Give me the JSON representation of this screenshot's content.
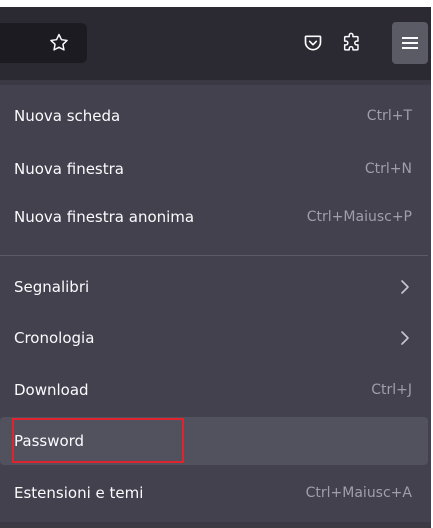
{
  "toolbar": {
    "icons": {
      "bookmark": "star-outline-icon",
      "pocket": "pocket-icon",
      "extensions": "puzzle-piece-icon",
      "menu": "hamburger-menu-icon"
    }
  },
  "menu": {
    "items": [
      {
        "label": "Nuova scheda",
        "shortcut": "Ctrl+T"
      },
      {
        "label": "Nuova finestra",
        "shortcut": "Ctrl+N"
      },
      {
        "label": "Nuova finestra anonima",
        "shortcut": "Ctrl+Maiusc+P"
      },
      {
        "label": "Segnalibri",
        "shortcut": ""
      },
      {
        "label": "Cronologia",
        "shortcut": ""
      },
      {
        "label": "Download",
        "shortcut": "Ctrl+J"
      },
      {
        "label": "Password",
        "shortcut": ""
      },
      {
        "label": "Estensioni e temi",
        "shortcut": "Ctrl+Maiusc+A"
      }
    ]
  },
  "colors": {
    "panel_background": "#42414d",
    "toolbar_background": "#2b2a33",
    "text": "#fbfbfe",
    "shortcut_text": "#9f9ea9",
    "highlight_border": "#e0242f",
    "selected_item": "#52515e"
  }
}
